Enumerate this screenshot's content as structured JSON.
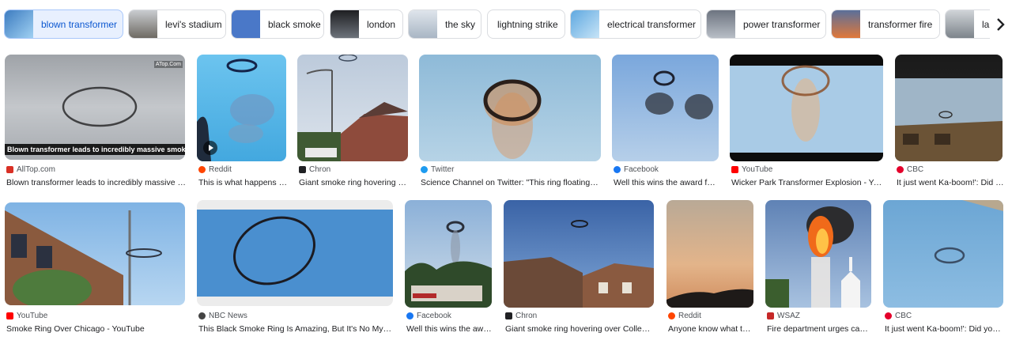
{
  "chips": [
    {
      "label": "blown transformer",
      "active": true,
      "thumb": "#5c9fd8"
    },
    {
      "label": "levi's stadium",
      "active": false,
      "thumb": "#8b8f93"
    },
    {
      "label": "black smoke",
      "active": false,
      "thumb": "#4a78c8"
    },
    {
      "label": "london",
      "active": false,
      "thumb": "#3d3f44"
    },
    {
      "label": "the sky",
      "active": false,
      "thumb": "#b9c7d6"
    },
    {
      "label": "lightning strike",
      "active": false,
      "thumb": ""
    },
    {
      "label": "electrical transformer",
      "active": false,
      "thumb": "#7fbbe6"
    },
    {
      "label": "power transformer",
      "active": false,
      "thumb": "#8c9099"
    },
    {
      "label": "transformer fire",
      "active": false,
      "thumb": "#d06a3a"
    },
    {
      "label": "lahe",
      "active": false,
      "thumb": "#a0a6ad"
    }
  ],
  "next_icon": "chevron-right-icon",
  "results_row1": [
    {
      "source": "AllTop.com",
      "title": "Blown transformer leads to incredibly massive smo...",
      "favicon_color": "#d93025",
      "overlay_caption": "Blown transformer leads to incredibly massive smoke ring",
      "watermark": "ATop.Com"
    },
    {
      "source": "Reddit",
      "title": "This is what happens w...",
      "favicon_color": "#ff4500"
    },
    {
      "source": "Chron",
      "title": "Giant smoke ring hovering ov...",
      "favicon_color": "#202124"
    },
    {
      "source": "Twitter",
      "title": "Science Channel on Twitter: \"This ring floating abov...",
      "favicon_color": "#1d9bf0"
    },
    {
      "source": "Facebook",
      "title": "Well this wins the award for....",
      "favicon_color": "#1877f2"
    },
    {
      "source": "YouTube",
      "title": "Wicker Park Transformer Explosion - YouT...",
      "favicon_color": "#ff0000"
    },
    {
      "source": "CBC",
      "title": "It just went Ka-boom!': Did yo...",
      "favicon_color": "#e4002b"
    }
  ],
  "results_row2": [
    {
      "source": "YouTube",
      "title": "Smoke Ring Over Chicago - YouTube",
      "favicon_color": "#ff0000"
    },
    {
      "source": "NBC News",
      "title": "This Black Smoke Ring Is Amazing, But It's No Mystery",
      "favicon_color": "#444444"
    },
    {
      "source": "Facebook",
      "title": "Well this wins the awar...",
      "favicon_color": "#1877f2"
    },
    {
      "source": "Chron",
      "title": "Giant smoke ring hovering over College St...",
      "favicon_color": "#202124"
    },
    {
      "source": "Reddit",
      "title": "Anyone know what this...",
      "favicon_color": "#ff4500"
    },
    {
      "source": "WSAZ",
      "title": "Fire department urges cauti...",
      "favicon_color": "#c62828"
    },
    {
      "source": "CBC",
      "title": "It just went Ka-boom!': Did you s...",
      "favicon_color": "#e4002b"
    }
  ]
}
